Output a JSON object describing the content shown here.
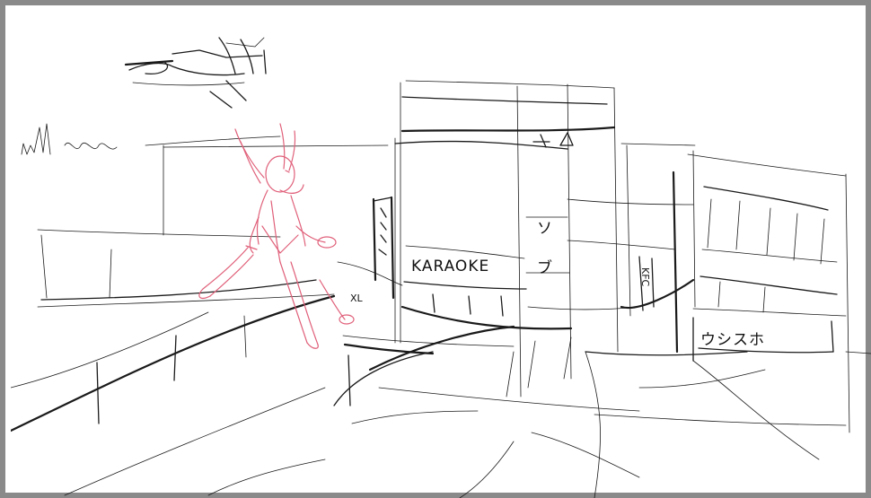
{
  "signs": {
    "karaoke": "KARAOKE",
    "katakana_top": "ソ",
    "katakana_bottom": "ブ",
    "kfc": "KFC",
    "bottom_right": "ウシスホ",
    "small_left": "XL"
  },
  "colors": {
    "ink": "#1a1a1a",
    "character": "#e0607a",
    "frame": "#8a8a8a",
    "paper": "#ffffff"
  }
}
